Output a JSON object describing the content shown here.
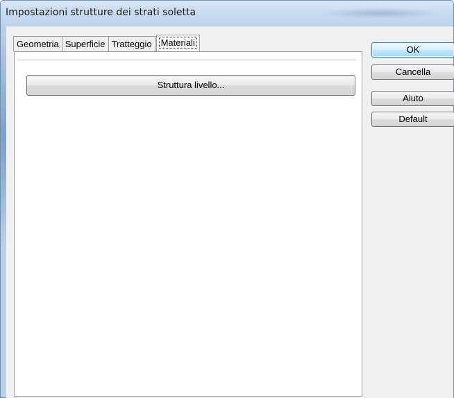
{
  "window": {
    "title": "Impostazioni strutture dei strati soletta"
  },
  "tabs": [
    {
      "label": "Geometria",
      "active": false
    },
    {
      "label": "Superficie",
      "active": false
    },
    {
      "label": "Tratteggio",
      "active": false
    },
    {
      "label": "Materiali",
      "active": true
    }
  ],
  "panel": {
    "struttura_button_label": "Struttura livello..."
  },
  "buttons": {
    "ok": "OK",
    "cancel": "Cancella",
    "help": "Aiuto",
    "default": "Default"
  }
}
